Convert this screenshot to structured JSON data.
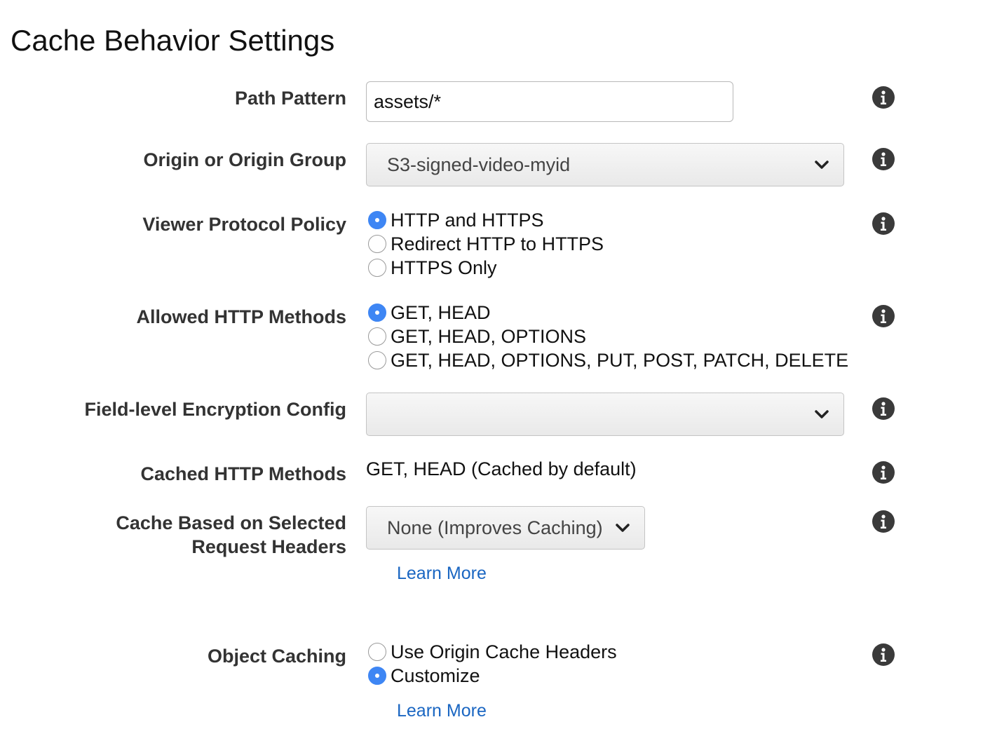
{
  "page": {
    "title": "Cache Behavior Settings"
  },
  "fields": {
    "path_pattern": {
      "label": "Path Pattern",
      "value": "assets/*"
    },
    "origin": {
      "label": "Origin or Origin Group",
      "selected": "S3-signed-video-myid"
    },
    "viewer_protocol": {
      "label": "Viewer Protocol Policy",
      "options": [
        "HTTP and HTTPS",
        "Redirect HTTP to HTTPS",
        "HTTPS Only"
      ],
      "selected_index": 0
    },
    "allowed_methods": {
      "label": "Allowed HTTP Methods",
      "options": [
        "GET, HEAD",
        "GET, HEAD, OPTIONS",
        "GET, HEAD, OPTIONS, PUT, POST, PATCH, DELETE"
      ],
      "selected_index": 0
    },
    "field_level_encryption": {
      "label": "Field-level Encryption Config",
      "selected": ""
    },
    "cached_methods": {
      "label": "Cached HTTP Methods",
      "value": "GET, HEAD (Cached by default)"
    },
    "cache_headers": {
      "label_line1": "Cache Based on Selected",
      "label_line2": "Request Headers",
      "selected": "None (Improves Caching)",
      "learn_more": "Learn More"
    },
    "object_caching": {
      "label": "Object Caching",
      "options": [
        "Use Origin Cache Headers",
        "Customize"
      ],
      "selected_index": 1,
      "learn_more": "Learn More"
    }
  },
  "icons": {
    "info": "info-icon",
    "dropdown": "chevron-down-icon"
  },
  "colors": {
    "radio_selected": "#3e86f4",
    "link": "#1a66c2",
    "info_icon": "#3a3a3a"
  }
}
